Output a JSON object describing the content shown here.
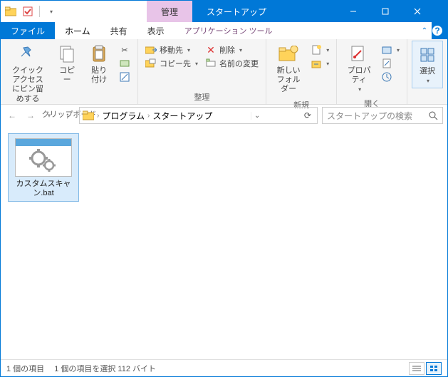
{
  "titlebar": {
    "manage_tab": "管理",
    "location_tab": "スタートアップ"
  },
  "ribbon_tabs": {
    "file": "ファイル",
    "home": "ホーム",
    "share": "共有",
    "view": "表示",
    "app_tools": "アプリケーション ツール"
  },
  "ribbon": {
    "clipboard": {
      "quick_access": "クイック アクセスにピン留めする",
      "copy": "コピー",
      "paste": "貼り付け",
      "group_label": "クリップボード"
    },
    "organize": {
      "move_to": "移動先",
      "copy_to": "コピー先",
      "delete": "削除",
      "rename": "名前の変更",
      "group_label": "整理"
    },
    "new": {
      "new_folder": "新しい\nフォルダー",
      "group_label": "新規"
    },
    "open": {
      "properties": "プロパティ",
      "group_label": "開く"
    },
    "select": {
      "select": "選択",
      "group_label": ""
    }
  },
  "address": {
    "crumb1": "プログラム",
    "crumb2": "スタートアップ",
    "search_placeholder": "スタートアップの検索"
  },
  "files": [
    {
      "name": "カスタムスキャン.bat"
    }
  ],
  "status": {
    "count": "1 個の項目",
    "selection": "1 個の項目を選択 112 バイト"
  }
}
